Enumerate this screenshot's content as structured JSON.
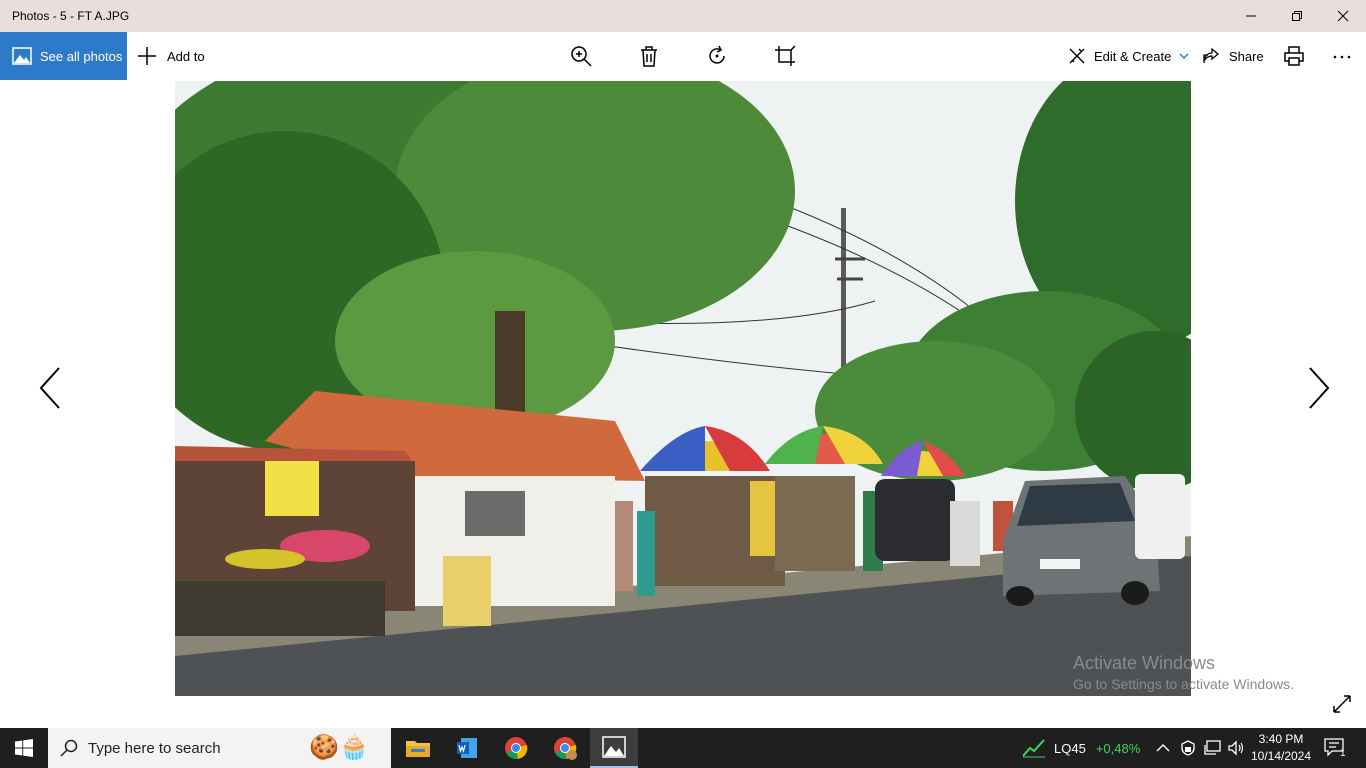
{
  "window": {
    "title": "Photos - 5 - FT A.JPG"
  },
  "toolbar": {
    "see_all_label": "See all photos",
    "add_to_label": "Add to",
    "edit_create_label": "Edit & Create",
    "share_label": "Share"
  },
  "watermark": {
    "line1": "Activate Windows",
    "line2": "Go to Settings to activate Windows."
  },
  "taskbar": {
    "search_placeholder": "Type here to search",
    "stock_name": "LQ45",
    "stock_change": "+0,48%",
    "time": "3:40 PM",
    "date": "10/14/2024",
    "notification_count": "1"
  },
  "colors": {
    "accent": "#2f79c9",
    "titlebar": "#e8dede",
    "taskbar": "#1f1f1f",
    "stock_up": "#3fd35f"
  }
}
